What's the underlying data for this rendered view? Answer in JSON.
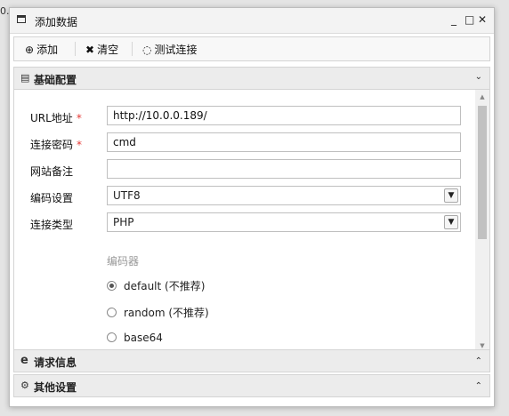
{
  "background": {
    "fragment": "0."
  },
  "window": {
    "title": "添加数据",
    "controls": {
      "minimize": "_",
      "maximize": "□",
      "close": "✕"
    }
  },
  "toolbar": {
    "add": {
      "icon": "plus-circle-icon",
      "glyph": "⊕",
      "label": "添加"
    },
    "clear": {
      "icon": "close-icon",
      "glyph": "✖",
      "label": "清空"
    },
    "test": {
      "icon": "spinner-icon",
      "glyph": "◌",
      "label": "测试连接"
    }
  },
  "sections": {
    "basic": {
      "icon": "document-icon",
      "glyph": "▤",
      "label": "基础配置",
      "chevron": "⌄"
    },
    "request": {
      "icon": "ie-icon",
      "glyph": "e",
      "label": "请求信息",
      "chevron": "⌃"
    },
    "other": {
      "icon": "gears-icon",
      "glyph": "⚙",
      "label": "其他设置",
      "chevron": "⌃"
    }
  },
  "form": {
    "url": {
      "label": "URL地址",
      "required": "*",
      "value": "http://10.0.0.189/"
    },
    "password": {
      "label": "连接密码",
      "required": "*",
      "value": "cmd"
    },
    "note": {
      "label": "网站备注",
      "value": ""
    },
    "encoding": {
      "label": "编码设置",
      "value": "UTF8"
    },
    "type": {
      "label": "连接类型",
      "value": "PHP"
    }
  },
  "encoder": {
    "label": "编码器",
    "options": [
      {
        "label": "default (不推荐)",
        "checked": true
      },
      {
        "label": "random (不推荐)",
        "checked": false
      },
      {
        "label": "base64",
        "checked": false
      }
    ]
  },
  "scroll": {
    "up": "▲",
    "down": "▼"
  }
}
